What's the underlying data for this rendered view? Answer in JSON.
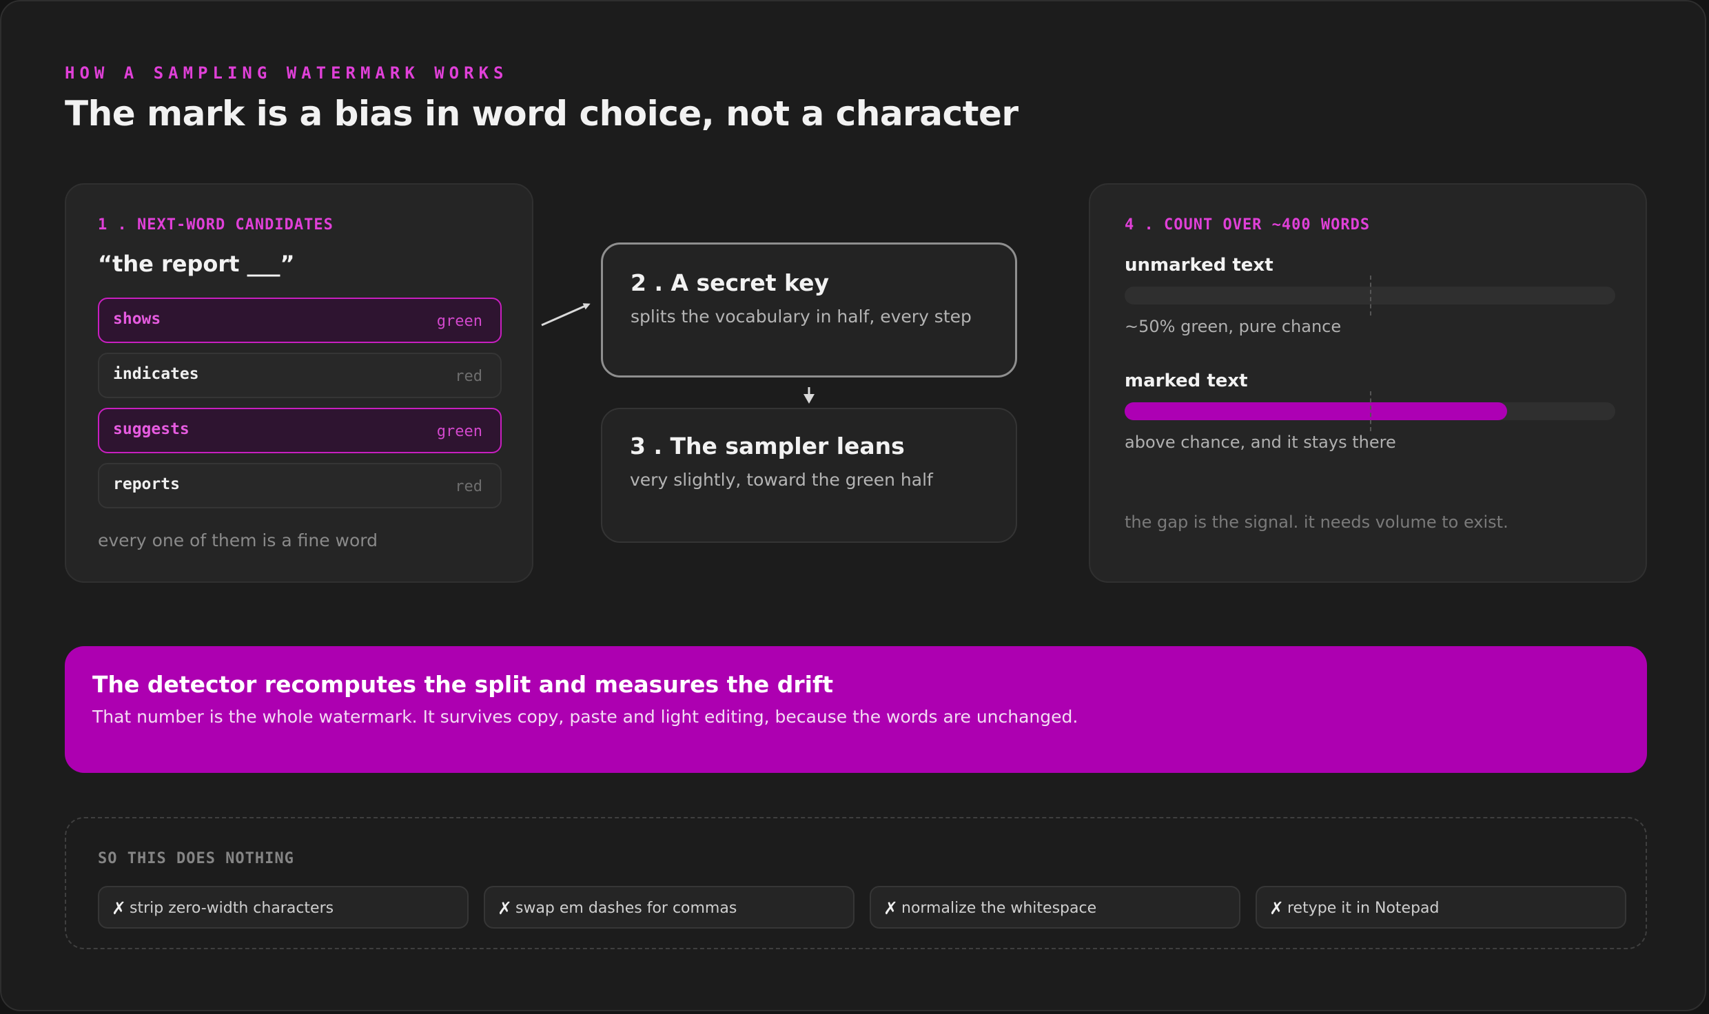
{
  "header": {
    "eyebrow": "HOW A SAMPLING WATERMARK WORKS",
    "title": "The mark is a bias in word choice, not a character"
  },
  "candidates_card": {
    "label": "1 . NEXT-WORD CANDIDATES",
    "phrase": "“the report ___”",
    "candidates": [
      {
        "word": "shows",
        "tag": "green"
      },
      {
        "word": "indicates",
        "tag": "red"
      },
      {
        "word": "suggests",
        "tag": "green"
      },
      {
        "word": "reports",
        "tag": "red"
      }
    ],
    "note": "every one of them is a fine word"
  },
  "secret_key": {
    "heading": "2 . A secret key",
    "subtext": "splits the vocabulary in half, every step"
  },
  "sampler": {
    "heading": "3 . The sampler leans",
    "subtext": "very slightly, toward the green half"
  },
  "count_card": {
    "label": "4 . COUNT OVER ~400 WORDS",
    "unmarked": {
      "title": "unmarked text",
      "green_fraction": 0.0,
      "subtitle": "~50% green, pure chance"
    },
    "marked": {
      "title": "marked text",
      "green_fraction": 0.78,
      "subtitle": "above chance, and it stays there"
    },
    "chance_marker_fraction": 0.5,
    "note": "the gap is the signal. it needs volume to exist."
  },
  "banner": {
    "heading": "The detector recomputes the split and measures the drift",
    "subtext": "That number is the whole watermark. It survives copy, paste and light editing, because the words are unchanged."
  },
  "does_nothing": {
    "label": "SO THIS DOES NOTHING",
    "mark": "✗",
    "items": [
      "strip zero-width characters",
      "swap em dashes for commas",
      "normalize the whitespace",
      "retype it in Notepad"
    ]
  },
  "colors": {
    "accent": "#e040d8",
    "banner": "#ad00b1",
    "green_fill": "#ad00b4",
    "background": "#1c1c1c",
    "card": "#252525"
  }
}
